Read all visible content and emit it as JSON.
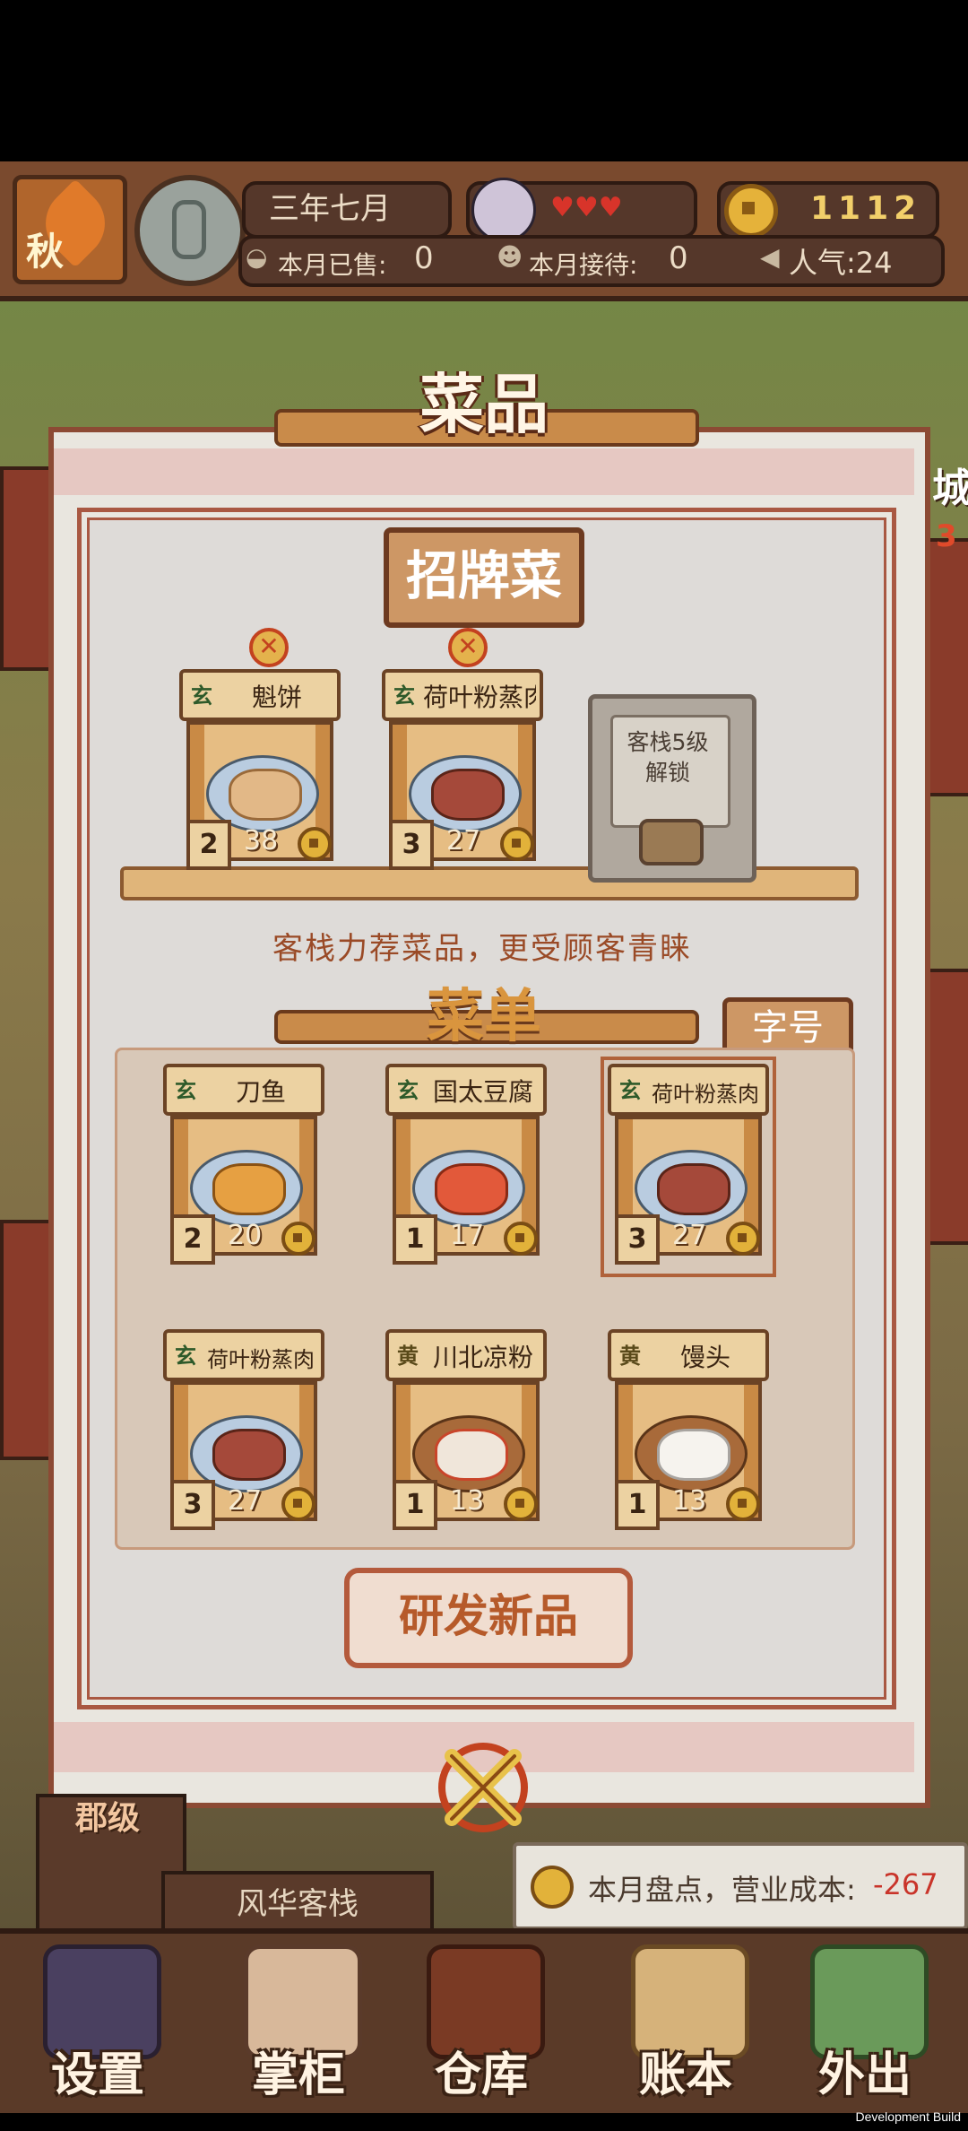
{
  "hud": {
    "season": "秋",
    "date": "三年七月",
    "coins": "1112",
    "sold_label": "本月已售:",
    "sold_value": "0",
    "served_label": "本月接待:",
    "served_value": "0",
    "popularity": "人气:24"
  },
  "side_labels": {
    "right_a": "城",
    "right_b": "3"
  },
  "dialog": {
    "title": "菜品",
    "signature_title": "招牌菜",
    "signature_dishes": [
      {
        "name": "魁饼",
        "tag": "玄",
        "level": "2",
        "price": "38"
      },
      {
        "name": "荷叶粉蒸肉",
        "tag": "玄",
        "level": "3",
        "price": "27"
      }
    ],
    "locked_slot": {
      "line1": "客栈5级",
      "line2": "解锁"
    },
    "hint": "客栈力荐菜品，更受顾客青睐",
    "menu_title": "菜单",
    "font_button": "字号",
    "menu_dishes": [
      {
        "name": "刀鱼",
        "tag": "玄",
        "level": "2",
        "price": "20"
      },
      {
        "name": "国太豆腐",
        "tag": "玄",
        "level": "1",
        "price": "17"
      },
      {
        "name": "荷叶粉蒸肉",
        "tag": "玄",
        "level": "3",
        "price": "27"
      },
      {
        "name": "荷叶粉蒸肉",
        "tag": "玄",
        "level": "3",
        "price": "27"
      },
      {
        "name": "川北凉粉",
        "tag": "黄",
        "level": "1",
        "price": "13"
      },
      {
        "name": "馒头",
        "tag": "黄",
        "level": "1",
        "price": "13"
      }
    ],
    "research_button": "研发新品"
  },
  "inn": {
    "rank": "郡级",
    "name": "风华客栈"
  },
  "report": "本月盘点，营业成本:",
  "report_value": "-267",
  "nav": [
    {
      "label": "设置",
      "icon": "yin-yang-icon"
    },
    {
      "label": "掌柜",
      "icon": "shopkeeper-icon"
    },
    {
      "label": "仓库",
      "icon": "chest-icon"
    },
    {
      "label": "账本",
      "icon": "scroll-icon"
    },
    {
      "label": "外出",
      "icon": "travel-icon"
    }
  ],
  "footer": "Development Build",
  "colors": {
    "accent": "#b45a3c",
    "gold": "#e2b23a",
    "panel": "#dedbd8"
  }
}
